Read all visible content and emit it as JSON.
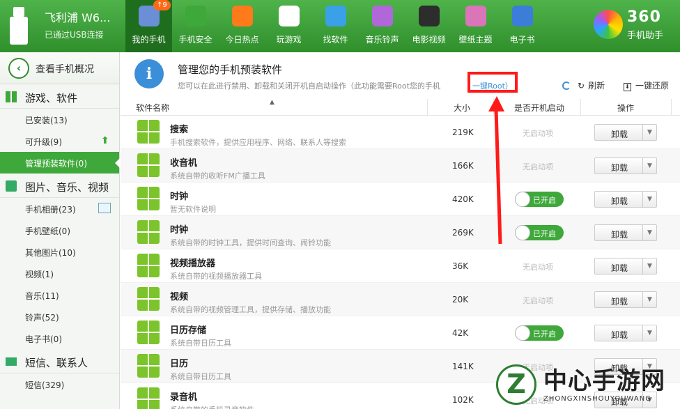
{
  "device": {
    "name": "飞利浦 W6...",
    "status": "已通过USB连接"
  },
  "nav": [
    {
      "label": "我的手机",
      "icon": "android-phone-icon",
      "badge": "↑9",
      "active": true
    },
    {
      "label": "手机安全",
      "icon": "shield-icon"
    },
    {
      "label": "今日热点",
      "icon": "star-icon"
    },
    {
      "label": "玩游戏",
      "icon": "gamepad-icon"
    },
    {
      "label": "找软件",
      "icon": "shopping-bag-icon"
    },
    {
      "label": "音乐铃声",
      "icon": "music-icon"
    },
    {
      "label": "电影视频",
      "icon": "film-icon"
    },
    {
      "label": "壁纸主题",
      "icon": "picture-icon"
    },
    {
      "label": "电子书",
      "icon": "book-icon"
    }
  ],
  "logo": {
    "title": "360",
    "subtitle": "手机助手"
  },
  "sidebar": {
    "back_label": "查看手机概况",
    "sections": [
      {
        "label": "游戏、软件",
        "items": [
          {
            "label": "已安装(13)"
          },
          {
            "label": "可升级(9)"
          },
          {
            "label": "管理预装软件(0)"
          }
        ]
      },
      {
        "label": "图片、音乐、视频",
        "items": [
          {
            "label": "手机相册(23)"
          },
          {
            "label": "手机壁纸(0)"
          },
          {
            "label": "其他图片(10)"
          },
          {
            "label": "视频(1)"
          },
          {
            "label": "音乐(11)"
          },
          {
            "label": "铃声(52)"
          },
          {
            "label": "电子书(0)"
          }
        ]
      },
      {
        "label": "短信、联系人",
        "items": [
          {
            "label": "短信(329)"
          }
        ]
      }
    ]
  },
  "header": {
    "title": "管理您的手机预装软件",
    "desc": "您可以在此进行禁用、卸载和关闭开机自启动操作（此功能需要Root您的手机",
    "root_link": "一键Root",
    "root_close": "）",
    "refresh": "刷新",
    "restore": "一键还原"
  },
  "table": {
    "columns": [
      "软件名称",
      "大小",
      "是否开机启动",
      "操作"
    ],
    "rows": [
      {
        "name": "搜索",
        "desc": "手机搜索软件，提供应用程序、网络、联系人等搜索",
        "size": "219K",
        "boot": "无启动项",
        "action": "卸载"
      },
      {
        "name": "收音机",
        "desc": "系统自带的收听FM广播工具",
        "size": "166K",
        "boot": "无启动项",
        "action": "卸载"
      },
      {
        "name": "时钟",
        "desc": "暂无软件说明",
        "size": "420K",
        "boot": "已开启",
        "action": "卸载"
      },
      {
        "name": "时钟",
        "desc": "系统自带的时钟工具，提供时间查询、闹铃功能",
        "size": "269K",
        "boot": "已开启",
        "action": "卸载"
      },
      {
        "name": "视频播放器",
        "desc": "系统自带的视频播放器工具",
        "size": "36K",
        "boot": "无启动项",
        "action": "卸载"
      },
      {
        "name": "视频",
        "desc": "系统自带的视频管理工具，提供存储、播放功能",
        "size": "20K",
        "boot": "无启动项",
        "action": "卸载"
      },
      {
        "name": "日历存储",
        "desc": "系统自带日历工具",
        "size": "42K",
        "boot": "已开启",
        "action": "卸载"
      },
      {
        "name": "日历",
        "desc": "系统自带日历工具",
        "size": "141K",
        "boot": "无启动项",
        "action": "卸载"
      },
      {
        "name": "录音机",
        "desc": "系统自带的手机录音软件",
        "size": "102K",
        "boot": "无启动项",
        "action": "卸载"
      }
    ]
  },
  "watermark": {
    "title": "中心手游网",
    "sub": "ZHONGXINSHOUYOUWANG",
    "letter": "Z"
  },
  "colors": {
    "brand_green": "#3ea83a",
    "accent_red": "#ff1a1a",
    "link_blue": "#3b8fd8"
  }
}
